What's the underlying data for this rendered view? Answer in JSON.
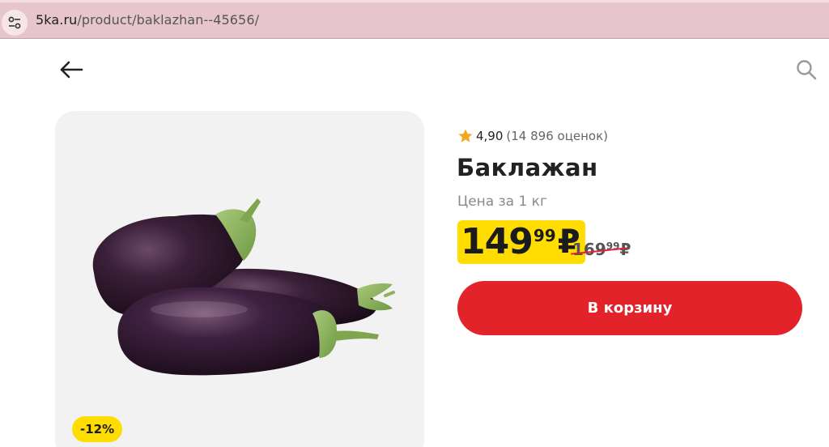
{
  "browser": {
    "url_host": "5ka.ru",
    "url_path": "/product/baklazhan--45656/",
    "site_info_icon": "tune-icon"
  },
  "header": {
    "back_icon": "arrow-left-icon",
    "search_icon": "search-icon"
  },
  "product": {
    "rating_icon": "star-icon",
    "rating_value": "4,90",
    "rating_count": "(14 896 оценок)",
    "title": "Баклажан",
    "unit": "Цена за 1 кг",
    "price_rub": "149",
    "price_kop": "99",
    "currency": "₽",
    "old_price_rub": "169",
    "old_price_kop": "99",
    "old_currency": "₽",
    "discount": "-12%",
    "cart_label": "В корзину"
  },
  "colors": {
    "accent_red": "#e3232a",
    "price_yellow": "#ffdd00",
    "star_orange": "#f5a623",
    "address_bar": "#e6c6cc"
  }
}
